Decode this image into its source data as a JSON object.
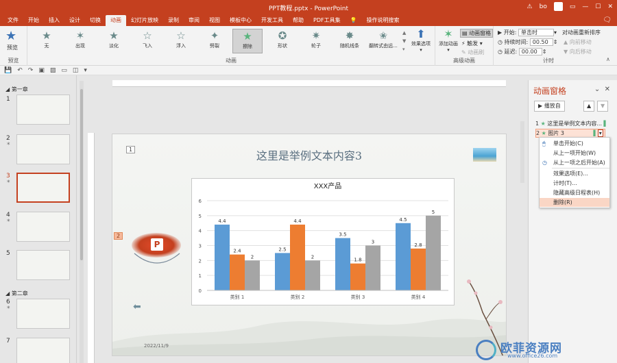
{
  "titlebar": {
    "title": "PPT教程.pptx - PowerPoint",
    "warning": "⚠",
    "user": "bo"
  },
  "tabs": [
    "文件",
    "开始",
    "插入",
    "设计",
    "切换",
    "动画",
    "幻灯片放映",
    "录制",
    "审阅",
    "视图",
    "模板中心",
    "开发工具",
    "帮助",
    "PDF工具集",
    "操作说明搜索"
  ],
  "active_tab": "动画",
  "ribbon": {
    "preview": {
      "label": "预览",
      "group": "预览"
    },
    "effects": [
      "无",
      "出现",
      "淡化",
      "飞入",
      "浮入",
      "劈裂",
      "擦除",
      "形状",
      "轮子",
      "随机线条",
      "翻转式由远..."
    ],
    "selected_effect": "擦除",
    "group_animation": "动画",
    "effect_options": "效果选项",
    "add_animation": "添加动画",
    "animation_pane": "动画窗格",
    "trigger": "触发",
    "animation_painter": "动画刷",
    "group_advanced": "高级动画",
    "start_label": "开始:",
    "start_value": "单击时",
    "duration_label": "持续时间:",
    "duration_value": "00.50",
    "delay_label": "延迟:",
    "delay_value": "00.00",
    "reorder": "对动画重新排序",
    "move_earlier": "向前移动",
    "move_later": "向后移动",
    "group_timing": "计时"
  },
  "sections": [
    "第一章",
    "第二章"
  ],
  "slides": [
    "1",
    "2",
    "3",
    "4",
    "5",
    "6",
    "7"
  ],
  "slide": {
    "title": "这里是举例文本内容3",
    "tag1": "1",
    "tag2": "2",
    "date": "2022/11/9",
    "logo_letter": "P"
  },
  "chart_data": {
    "type": "bar",
    "title": "XXX产品",
    "categories": [
      "类别 1",
      "类别 2",
      "类别 3",
      "类别 4"
    ],
    "series": [
      {
        "values": [
          4.4,
          2.5,
          3.5,
          4.5
        ],
        "color": "#5b9bd5"
      },
      {
        "values": [
          2.4,
          4.4,
          1.8,
          2.8
        ],
        "color": "#ed7d31"
      },
      {
        "values": [
          2,
          2,
          3,
          5
        ],
        "color": "#a5a5a5"
      }
    ],
    "ylim": [
      0,
      6
    ],
    "yticks": [
      "0",
      "1",
      "2",
      "3",
      "4",
      "5",
      "6"
    ],
    "grid": true
  },
  "pane": {
    "title": "动画窗格",
    "play": "播放自",
    "items": [
      {
        "num": "1",
        "label": "这里是举例文本内容..."
      },
      {
        "num": "2",
        "label": "图片 3"
      }
    ]
  },
  "menu": [
    "单击开始(C)",
    "从上一项开始(W)",
    "从上一项之后开始(A)",
    "效果选项(E)...",
    "计时(T)...",
    "隐藏高级日程表(H)",
    "删除(R)"
  ],
  "watermark": {
    "name": "欧菲资源网",
    "url": "www.office26.com"
  }
}
